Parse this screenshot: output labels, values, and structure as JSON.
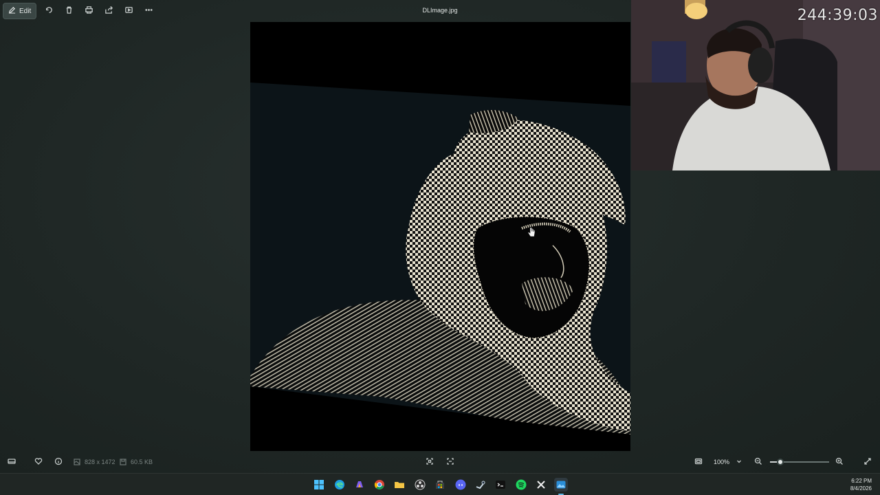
{
  "toolbar": {
    "edit_label": "Edit",
    "file_name": "DLImage.jpg",
    "icons": [
      "pen-icon",
      "rotate-icon",
      "delete-icon",
      "print-icon",
      "share-icon",
      "slideshow-icon",
      "more-icon"
    ]
  },
  "webcam": {
    "timer": "244:39:03"
  },
  "statusbar": {
    "dimensions": "828 x 1472",
    "file_size": "60.5 KB",
    "zoom": "100%"
  },
  "zoom_slider": {
    "value_fraction": 0.17
  },
  "taskbar": {
    "apps": [
      "start",
      "edge",
      "copilot",
      "chrome",
      "file-explorer",
      "obs",
      "store",
      "discord",
      "steam",
      "terminal",
      "spotify",
      "capcut",
      "photos"
    ],
    "time": "6:22 PM",
    "date": "8/4/2026"
  },
  "colors": {
    "accent": "#5fb7e5",
    "background": "#1f2725"
  }
}
